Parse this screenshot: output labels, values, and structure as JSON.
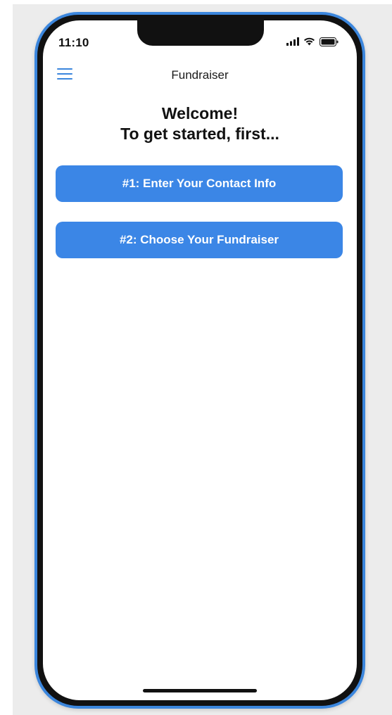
{
  "status_bar": {
    "time": "11:10",
    "icons": [
      "signal-icon",
      "wifi-icon",
      "battery-icon"
    ]
  },
  "nav": {
    "title": "Fundraiser",
    "menu_icon": "hamburger-menu-icon"
  },
  "main": {
    "heading_line1": "Welcome!",
    "heading_line2": "To get started, first...",
    "buttons": [
      {
        "label": "#1: Enter Your Contact Info"
      },
      {
        "label": "#2: Choose Your Fundraiser"
      }
    ]
  },
  "colors": {
    "accent": "#3b86e6",
    "frame_outline": "#3b86dd",
    "text": "#111111"
  }
}
